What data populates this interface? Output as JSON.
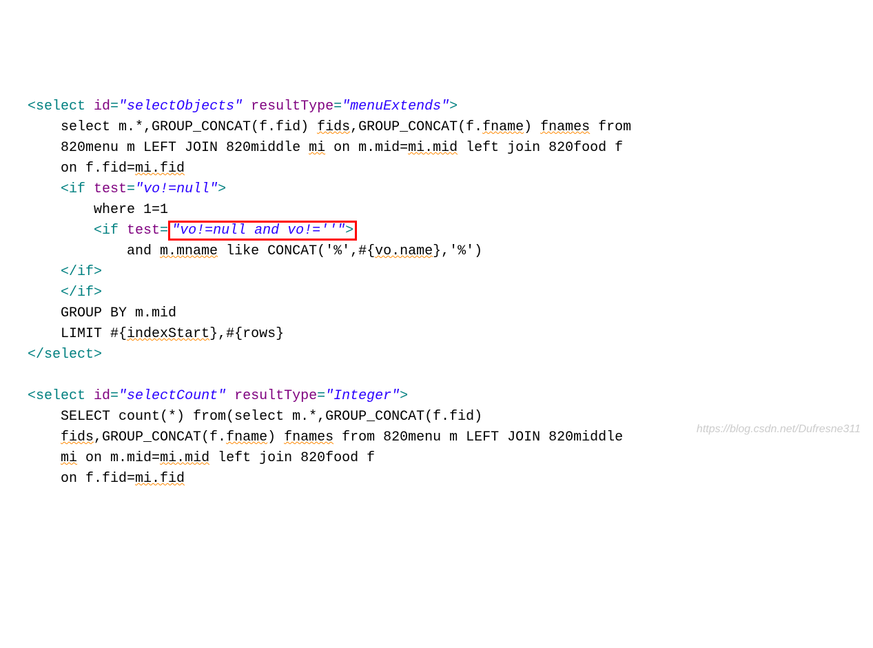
{
  "code": {
    "line1": {
      "tag_open": "<select ",
      "attr1_name": "id",
      "attr1_value": "\"selectObjects\"",
      "attr2_name": " resultType",
      "attr2_value": "\"menuExtends\"",
      "tag_close": ">"
    },
    "line2": {
      "indent": "    ",
      "t1": "select m.*,GROUP_CONCAT(f.fid) ",
      "u1": "fids",
      "t2": ",GROUP_CONCAT(f.",
      "u2": "fname",
      "t3": ") ",
      "u3": "fnames",
      "t4": " from"
    },
    "line3": {
      "indent": "    ",
      "t1": "820menu m LEFT JOIN 820middle ",
      "u1": "mi",
      "t2": " on m.mid=",
      "u2": "mi.mid",
      "t3": " left join 820food f"
    },
    "line4": {
      "indent": "    ",
      "t1": "on f.fid=",
      "u1": "mi.fid"
    },
    "line5": {
      "indent": "    ",
      "tag_open": "<if ",
      "attr_name": "test",
      "attr_value": "\"vo!=null\"",
      "tag_close": ">"
    },
    "line6": {
      "indent": "        ",
      "t1": "where 1=1"
    },
    "line7": {
      "indent": "        ",
      "tag_open": "<if ",
      "attr_name": "test",
      "eq": "=",
      "attr_value": "\"vo!=null and vo!=''\"",
      "tag_close": ">"
    },
    "line8": {
      "indent": "            ",
      "t1": "and ",
      "u1": "m.mname",
      "t2": " like CONCAT('%',#{",
      "u2": "vo.name",
      "t3": "},'%')"
    },
    "line9": {
      "indent": "    ",
      "tag": "</if>"
    },
    "line10": {
      "indent": "    ",
      "tag": "</if>"
    },
    "line11": {
      "indent": "    ",
      "t1": "GROUP BY m.mid"
    },
    "line12": {
      "indent": "    ",
      "t1": "LIMIT #{",
      "u1": "indexStart",
      "t2": "},#{rows}"
    },
    "line13": {
      "tag": "</select>"
    },
    "line15": {
      "tag_open": "<select ",
      "attr1_name": "id",
      "attr1_value": "\"selectCount\"",
      "attr2_name": " resultType",
      "attr2_value": "\"Integer\"",
      "tag_close": ">"
    },
    "line16": {
      "indent": "    ",
      "t1": "SELECT count(*) from(select m.*,GROUP_CONCAT(f.fid)"
    },
    "line17": {
      "indent": "    ",
      "u1": "fids",
      "t1": ",GROUP_CONCAT(f.",
      "u2": "fname",
      "t2": ") ",
      "u3": "fnames",
      "t3": " from 820menu m LEFT JOIN 820middle"
    },
    "line18": {
      "indent": "    ",
      "u1": "mi",
      "t1": " on m.mid=",
      "u2": "mi.mid",
      "t2": " left join 820food f"
    },
    "line19": {
      "indent": "    ",
      "t1": "on f.fid=",
      "u1": "mi.fid"
    }
  },
  "watermark": "https://blog.csdn.net/Dufresne311"
}
